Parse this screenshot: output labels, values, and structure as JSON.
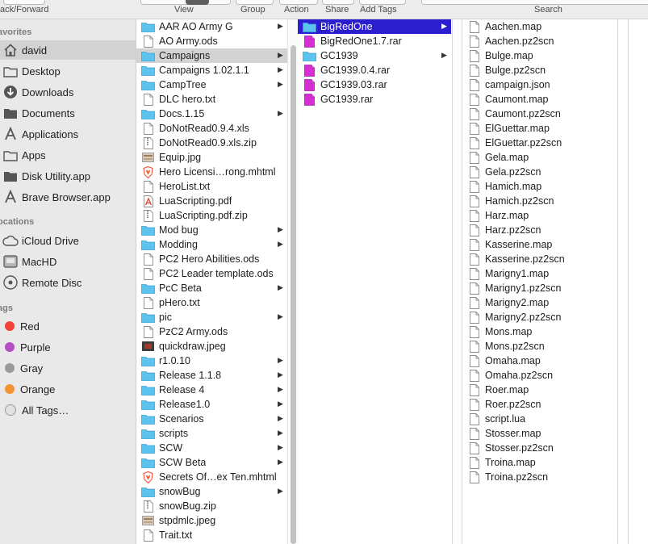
{
  "toolbar": {
    "back_forward": "ack/Forward",
    "view": "View",
    "group": "Group",
    "action": "Action",
    "share": "Share",
    "add_tags": "Add Tags",
    "search": "Search"
  },
  "sidebar": {
    "favorites_header": "avorites",
    "favorites": [
      {
        "label": "david",
        "icon": "home-icon",
        "selected": true
      },
      {
        "label": "Desktop",
        "icon": "folder-icon"
      },
      {
        "label": "Downloads",
        "icon": "download-icon"
      },
      {
        "label": "Documents",
        "icon": "document-icon"
      },
      {
        "label": "Applications",
        "icon": "applications-icon"
      },
      {
        "label": "Apps",
        "icon": "folder-icon"
      },
      {
        "label": "Disk Utility.app",
        "icon": "document-icon"
      },
      {
        "label": "Brave Browser.app",
        "icon": "applications-icon"
      }
    ],
    "locations_header": "ocations",
    "locations": [
      {
        "label": "iCloud Drive",
        "icon": "cloud-icon"
      },
      {
        "label": "MacHD",
        "icon": "hard-disk-icon"
      },
      {
        "label": "Remote Disc",
        "icon": "disc-icon"
      }
    ],
    "tags_header": "ags",
    "tags": [
      {
        "label": "Red",
        "color": "#f2423a"
      },
      {
        "label": "Purple",
        "color": "#b44fc3"
      },
      {
        "label": "Gray",
        "color": "#9a9a9a"
      },
      {
        "label": "Orange",
        "color": "#f59233"
      },
      {
        "label": "All Tags…",
        "color": "#e1e1e1"
      }
    ]
  },
  "column1": {
    "items": [
      {
        "name": "AAR AO Army G",
        "kind": "folder",
        "arrow": true
      },
      {
        "name": "AO Army.ods",
        "kind": "doc"
      },
      {
        "name": "Campaigns",
        "kind": "folder",
        "arrow": true,
        "selected": true
      },
      {
        "name": "Campaigns 1.02.1.1",
        "kind": "folder",
        "arrow": true
      },
      {
        "name": "CampTree",
        "kind": "folder",
        "arrow": true
      },
      {
        "name": "DLC hero.txt",
        "kind": "doc"
      },
      {
        "name": "Docs.1.15",
        "kind": "folder",
        "arrow": true
      },
      {
        "name": "DoNotRead0.9.4.xls",
        "kind": "doc"
      },
      {
        "name": "DoNotRead0.9.xls.zip",
        "kind": "zip"
      },
      {
        "name": "Equip.jpg",
        "kind": "image"
      },
      {
        "name": "Hero Licensi…rong.mhtml",
        "kind": "brave"
      },
      {
        "name": "HeroList.txt",
        "kind": "doc"
      },
      {
        "name": "LuaScripting.pdf",
        "kind": "pdf"
      },
      {
        "name": "LuaScripting.pdf.zip",
        "kind": "zip"
      },
      {
        "name": "Mod bug",
        "kind": "folder",
        "arrow": true
      },
      {
        "name": "Modding",
        "kind": "folder",
        "arrow": true
      },
      {
        "name": "PC2 Hero Abilities.ods",
        "kind": "doc"
      },
      {
        "name": "PC2 Leader template.ods",
        "kind": "doc"
      },
      {
        "name": "PcC Beta",
        "kind": "folder",
        "arrow": true
      },
      {
        "name": "pHero.txt",
        "kind": "doc"
      },
      {
        "name": "pic",
        "kind": "folder",
        "arrow": true
      },
      {
        "name": "PzC2 Army.ods",
        "kind": "doc"
      },
      {
        "name": "quickdraw.jpeg",
        "kind": "image-dark"
      },
      {
        "name": "r1.0.10",
        "kind": "folder",
        "arrow": true
      },
      {
        "name": "Release 1.1.8",
        "kind": "folder",
        "arrow": true
      },
      {
        "name": "Release 4",
        "kind": "folder",
        "arrow": true
      },
      {
        "name": "Release1.0",
        "kind": "folder",
        "arrow": true
      },
      {
        "name": "Scenarios",
        "kind": "folder",
        "arrow": true
      },
      {
        "name": "scripts",
        "kind": "folder",
        "arrow": true
      },
      {
        "name": "SCW",
        "kind": "folder",
        "arrow": true
      },
      {
        "name": "SCW Beta",
        "kind": "folder",
        "arrow": true
      },
      {
        "name": "Secrets Of…ex Ten.mhtml",
        "kind": "brave"
      },
      {
        "name": "snowBug",
        "kind": "folder",
        "arrow": true
      },
      {
        "name": "snowBug.zip",
        "kind": "zip"
      },
      {
        "name": "stpdmlc.jpeg",
        "kind": "image"
      },
      {
        "name": "Trait.txt",
        "kind": "doc"
      }
    ]
  },
  "column2": {
    "items": [
      {
        "name": "BigRedOne",
        "kind": "folder",
        "arrow": true,
        "active": true
      },
      {
        "name": "BigRedOne1.7.rar",
        "kind": "rar"
      },
      {
        "name": "GC1939",
        "kind": "folder",
        "arrow": true
      },
      {
        "name": "GC1939.0.4.rar",
        "kind": "rar"
      },
      {
        "name": "GC1939.03.rar",
        "kind": "rar"
      },
      {
        "name": "GC1939.rar",
        "kind": "rar"
      }
    ]
  },
  "column3": {
    "items": [
      {
        "name": "Aachen.map",
        "kind": "doc"
      },
      {
        "name": "Aachen.pz2scn",
        "kind": "doc"
      },
      {
        "name": "Bulge.map",
        "kind": "doc"
      },
      {
        "name": "Bulge.pz2scn",
        "kind": "doc"
      },
      {
        "name": "campaign.json",
        "kind": "doc"
      },
      {
        "name": "Caumont.map",
        "kind": "doc"
      },
      {
        "name": "Caumont.pz2scn",
        "kind": "doc"
      },
      {
        "name": "ElGuettar.map",
        "kind": "doc"
      },
      {
        "name": "ElGuettar.pz2scn",
        "kind": "doc"
      },
      {
        "name": "Gela.map",
        "kind": "doc"
      },
      {
        "name": "Gela.pz2scn",
        "kind": "doc"
      },
      {
        "name": "Hamich.map",
        "kind": "doc"
      },
      {
        "name": "Hamich.pz2scn",
        "kind": "doc"
      },
      {
        "name": "Harz.map",
        "kind": "doc"
      },
      {
        "name": "Harz.pz2scn",
        "kind": "doc"
      },
      {
        "name": "Kasserine.map",
        "kind": "doc"
      },
      {
        "name": "Kasserine.pz2scn",
        "kind": "doc"
      },
      {
        "name": "Marigny1.map",
        "kind": "doc"
      },
      {
        "name": "Marigny1.pz2scn",
        "kind": "doc"
      },
      {
        "name": "Marigny2.map",
        "kind": "doc"
      },
      {
        "name": "Marigny2.pz2scn",
        "kind": "doc"
      },
      {
        "name": "Mons.map",
        "kind": "doc"
      },
      {
        "name": "Mons.pz2scn",
        "kind": "doc"
      },
      {
        "name": "Omaha.map",
        "kind": "doc"
      },
      {
        "name": "Omaha.pz2scn",
        "kind": "doc"
      },
      {
        "name": "Roer.map",
        "kind": "doc"
      },
      {
        "name": "Roer.pz2scn",
        "kind": "doc"
      },
      {
        "name": "script.lua",
        "kind": "doc"
      },
      {
        "name": "Stosser.map",
        "kind": "doc"
      },
      {
        "name": "Stosser.pz2scn",
        "kind": "doc"
      },
      {
        "name": "Troina.map",
        "kind": "doc"
      },
      {
        "name": "Troina.pz2scn",
        "kind": "doc"
      }
    ]
  },
  "colors": {
    "folder": "#5cc3ef",
    "rar": "#d62fd3",
    "selection_active": "#2a1ecf",
    "selection_inactive": "#d3d3d3"
  }
}
